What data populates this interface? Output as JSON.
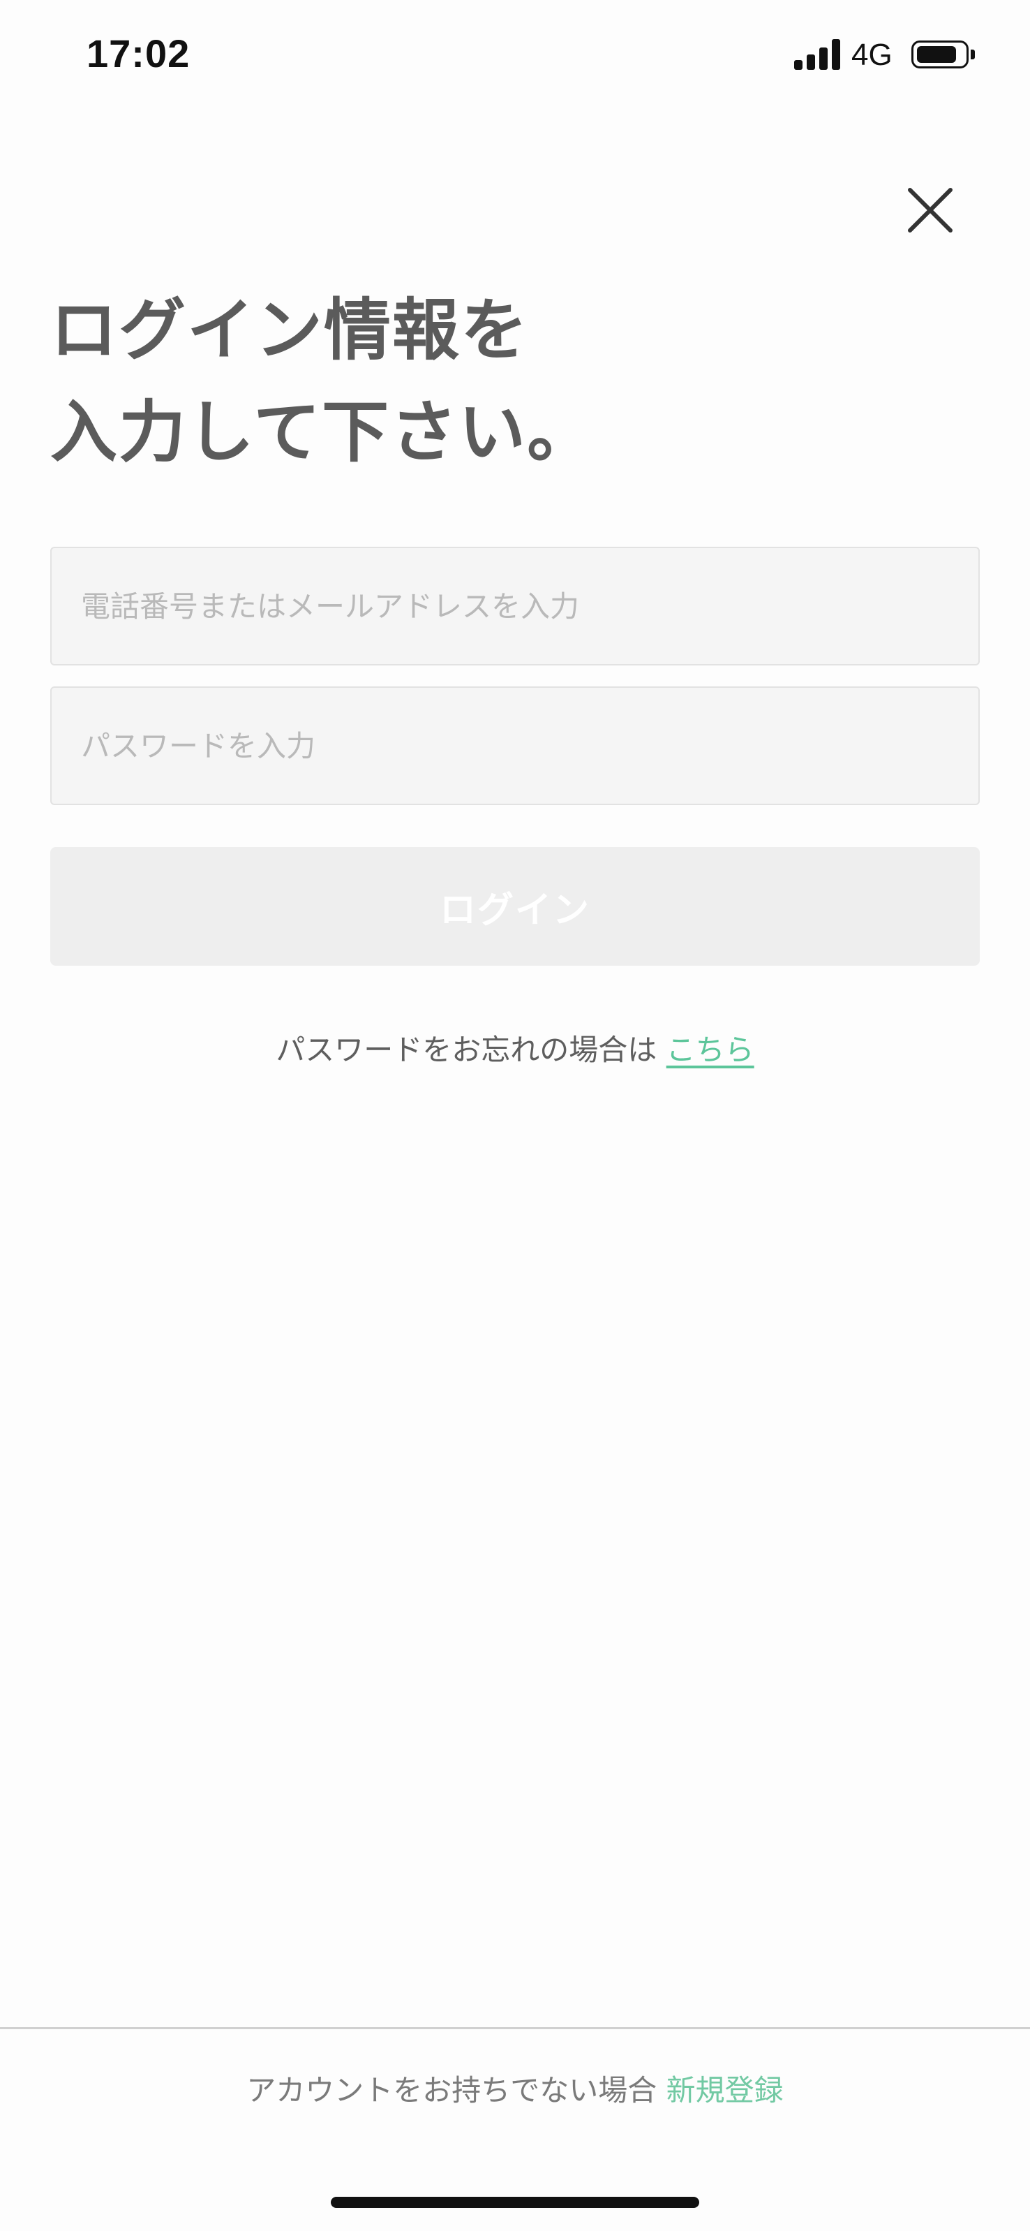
{
  "status_bar": {
    "time": "17:02",
    "network": "4G",
    "signal_bars": 4,
    "battery_icon": "battery-icon"
  },
  "header": {
    "close_icon": "close-icon"
  },
  "title": {
    "line1": "ログイン情報を",
    "line2": "入力して下さい。"
  },
  "form": {
    "id_placeholder": "電話番号またはメールアドレスを入力",
    "id_value": "",
    "password_placeholder": "パスワードを入力",
    "password_value": "",
    "login_label": "ログイン"
  },
  "forgot": {
    "text": "パスワードをお忘れの場合は",
    "link": "こちら"
  },
  "footer": {
    "text": "アカウントをお持ちでない場合",
    "link": "新規登録"
  },
  "colors": {
    "accent": "#5cc59a",
    "title": "#5b5b5b",
    "field_bg": "#f5f5f5",
    "button_disabled": "#eeeeee"
  }
}
